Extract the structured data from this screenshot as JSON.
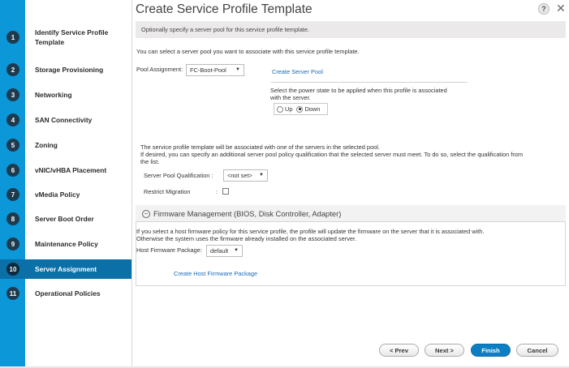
{
  "window": {
    "title": "Create Service Profile Template",
    "help_label": "?",
    "close_label": "✕"
  },
  "steps": [
    {
      "num": "1",
      "label": "Identify Service Profile Template"
    },
    {
      "num": "2",
      "label": "Storage Provisioning"
    },
    {
      "num": "3",
      "label": "Networking"
    },
    {
      "num": "4",
      "label": "SAN Connectivity"
    },
    {
      "num": "5",
      "label": "Zoning"
    },
    {
      "num": "6",
      "label": "vNIC/vHBA Placement"
    },
    {
      "num": "7",
      "label": "vMedia Policy"
    },
    {
      "num": "8",
      "label": "Server Boot Order"
    },
    {
      "num": "9",
      "label": "Maintenance Policy"
    },
    {
      "num": "10",
      "label": "Server Assignment",
      "active": true
    },
    {
      "num": "11",
      "label": "Operational Policies"
    }
  ],
  "main": {
    "info": "Optionally specify a server pool for this service profile template.",
    "pool_intro": "You can select a server pool you want to associate with this service profile template.",
    "pool_assignment_label": "Pool Assignment:",
    "pool_assignment_value": "FC-Boot-Pool",
    "create_server_pool": "Create Server Pool",
    "power_state_line1": "Select the power state to be applied when this profile is associated",
    "power_state_line2": "with the server.",
    "power_up": "Up",
    "power_down": "Down",
    "pool_note_1": "The service profile template will be associated with one of the servers in the selected pool.",
    "pool_note_2": "If desired, you can specify an additional server pool policy qualification that the selected server must meet. To do so, select the qualification from",
    "pool_note_3": "the list.",
    "qualification_label": "Server Pool Qualification :",
    "qualification_value": "<not set>",
    "restrict_label": "Restrict Migration",
    "restrict_colon": ":",
    "firmware": {
      "header": "Firmware Management (BIOS, Disk Controller, Adapter)",
      "collapse_symbol": "−",
      "text_1": "If you select a host firmware policy for this service profile, the profile will update the firmware on the server that it is associated with.",
      "text_2": "Otherwise the system uses the firmware already installed on the associated server.",
      "package_label": "Host Firmware Package:",
      "package_value": "default",
      "create_link": "Create Host Firmware Package"
    }
  },
  "footer": {
    "prev": "< Prev",
    "next": "Next >",
    "finish": "Finish",
    "cancel": "Cancel"
  },
  "colors": {
    "sidebar_blue": "#0c97d8",
    "active_step": "#0b6fa8",
    "primary_button": "#0c7fc4",
    "link": "#1a6bb8"
  }
}
